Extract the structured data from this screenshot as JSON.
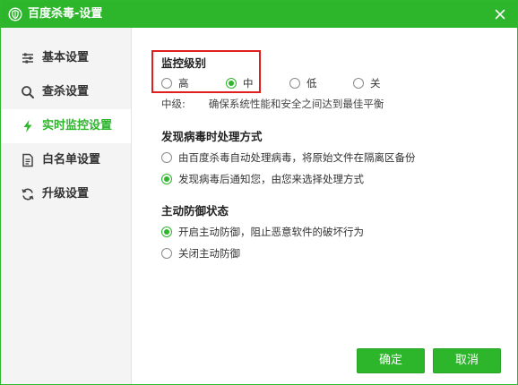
{
  "window": {
    "title": "百度杀毒-设置"
  },
  "sidebar": {
    "items": [
      {
        "label": "基本设置",
        "icon": "sliders-icon",
        "active": false
      },
      {
        "label": "查杀设置",
        "icon": "search-icon",
        "active": false
      },
      {
        "label": "实时监控设置",
        "icon": "lightning-icon",
        "active": true
      },
      {
        "label": "白名单设置",
        "icon": "document-icon",
        "active": false
      },
      {
        "label": "升级设置",
        "icon": "refresh-icon",
        "active": false
      }
    ]
  },
  "monitor_level": {
    "title": "监控级别",
    "options": [
      {
        "label": "高",
        "checked": false
      },
      {
        "label": "中",
        "checked": true
      },
      {
        "label": "低",
        "checked": false
      },
      {
        "label": "关",
        "checked": false
      }
    ],
    "description_prefix": "中级:",
    "description": "确保系统性能和安全之间达到最佳平衡"
  },
  "virus_action": {
    "title": "发现病毒时处理方式",
    "options": [
      {
        "label": "由百度杀毒自动处理病毒，将原始文件在隔离区备份",
        "checked": false
      },
      {
        "label": "发现病毒后通知您，由您来选择处理方式",
        "checked": true
      }
    ]
  },
  "active_defense": {
    "title": "主动防御状态",
    "options": [
      {
        "label": "开启主动防御，阻止恶意软件的破坏行为",
        "checked": true
      },
      {
        "label": "关闭主动防御",
        "checked": false
      }
    ]
  },
  "footer": {
    "ok_label": "确定",
    "cancel_label": "取消"
  },
  "colors": {
    "accent": "#2db52c",
    "highlight": "#e0201f",
    "sidebar_bg": "#f4f4f4"
  }
}
